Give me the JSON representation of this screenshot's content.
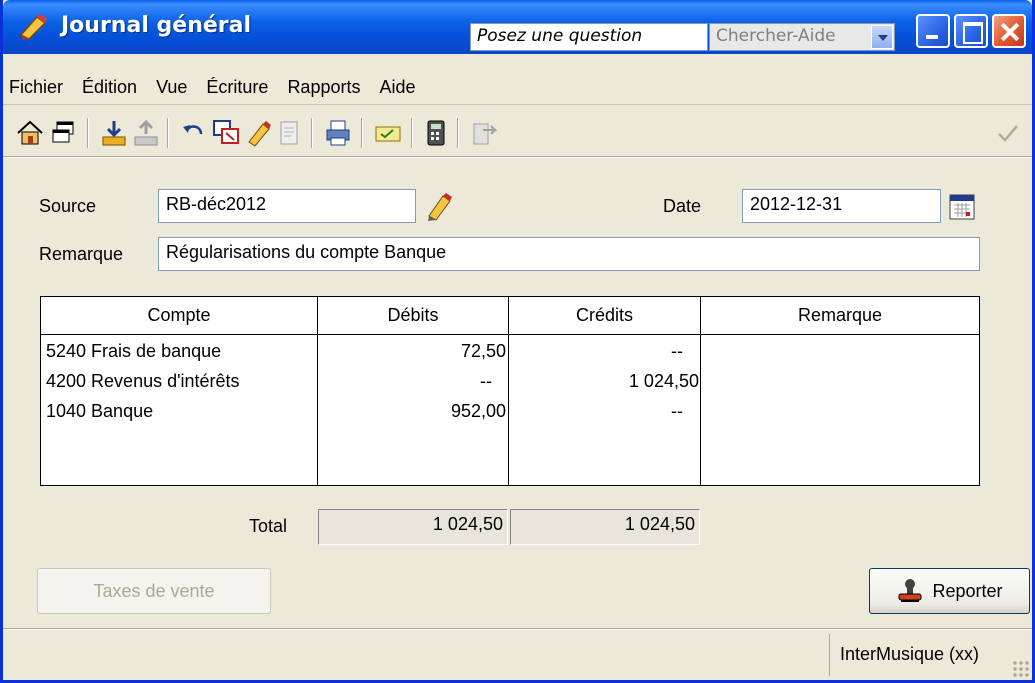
{
  "window": {
    "title": "Journal général",
    "question_placeholder": "Posez une question",
    "help_search": "Chercher-Aide"
  },
  "menu": [
    "Fichier",
    "Édition",
    "Vue",
    "Écriture",
    "Rapports",
    "Aide"
  ],
  "toolbar": {
    "icons": [
      "home-icon",
      "window-icon",
      "save-icon",
      "save-disabled-icon",
      "undo-icon",
      "lookup-icon",
      "edit-icon",
      "document-icon",
      "print-icon",
      "message-icon",
      "calculator-icon",
      "export-icon",
      "checkmark-icon"
    ]
  },
  "form": {
    "source_label": "Source",
    "source_value": "RB-déc2012",
    "date_label": "Date",
    "date_value": "2012-12-31",
    "remark_label": "Remarque",
    "remark_value": "Régularisations du compte Banque"
  },
  "grid": {
    "headers": [
      "Compte",
      "Débits",
      "Crédits",
      "Remarque"
    ],
    "rows": [
      {
        "account": "5240 Frais de banque",
        "debit": "72,50",
        "credit": "--",
        "remark": ""
      },
      {
        "account": "4200 Revenus d'intérêts",
        "debit": "--",
        "credit": "1 024,50",
        "remark": ""
      },
      {
        "account": "1040 Banque",
        "debit": "952,00",
        "credit": "--",
        "remark": ""
      }
    ]
  },
  "totals": {
    "label": "Total",
    "debits": "1 024,50",
    "credits": "1 024,50"
  },
  "buttons": {
    "sales_tax": "Taxes de vente",
    "post": "Reporter"
  },
  "status": {
    "company": "InterMusique (xx)"
  },
  "colors": {
    "titlebar": "#0a5fe8",
    "window_bg": "#ece9d8",
    "close_button": "#e05a30"
  }
}
